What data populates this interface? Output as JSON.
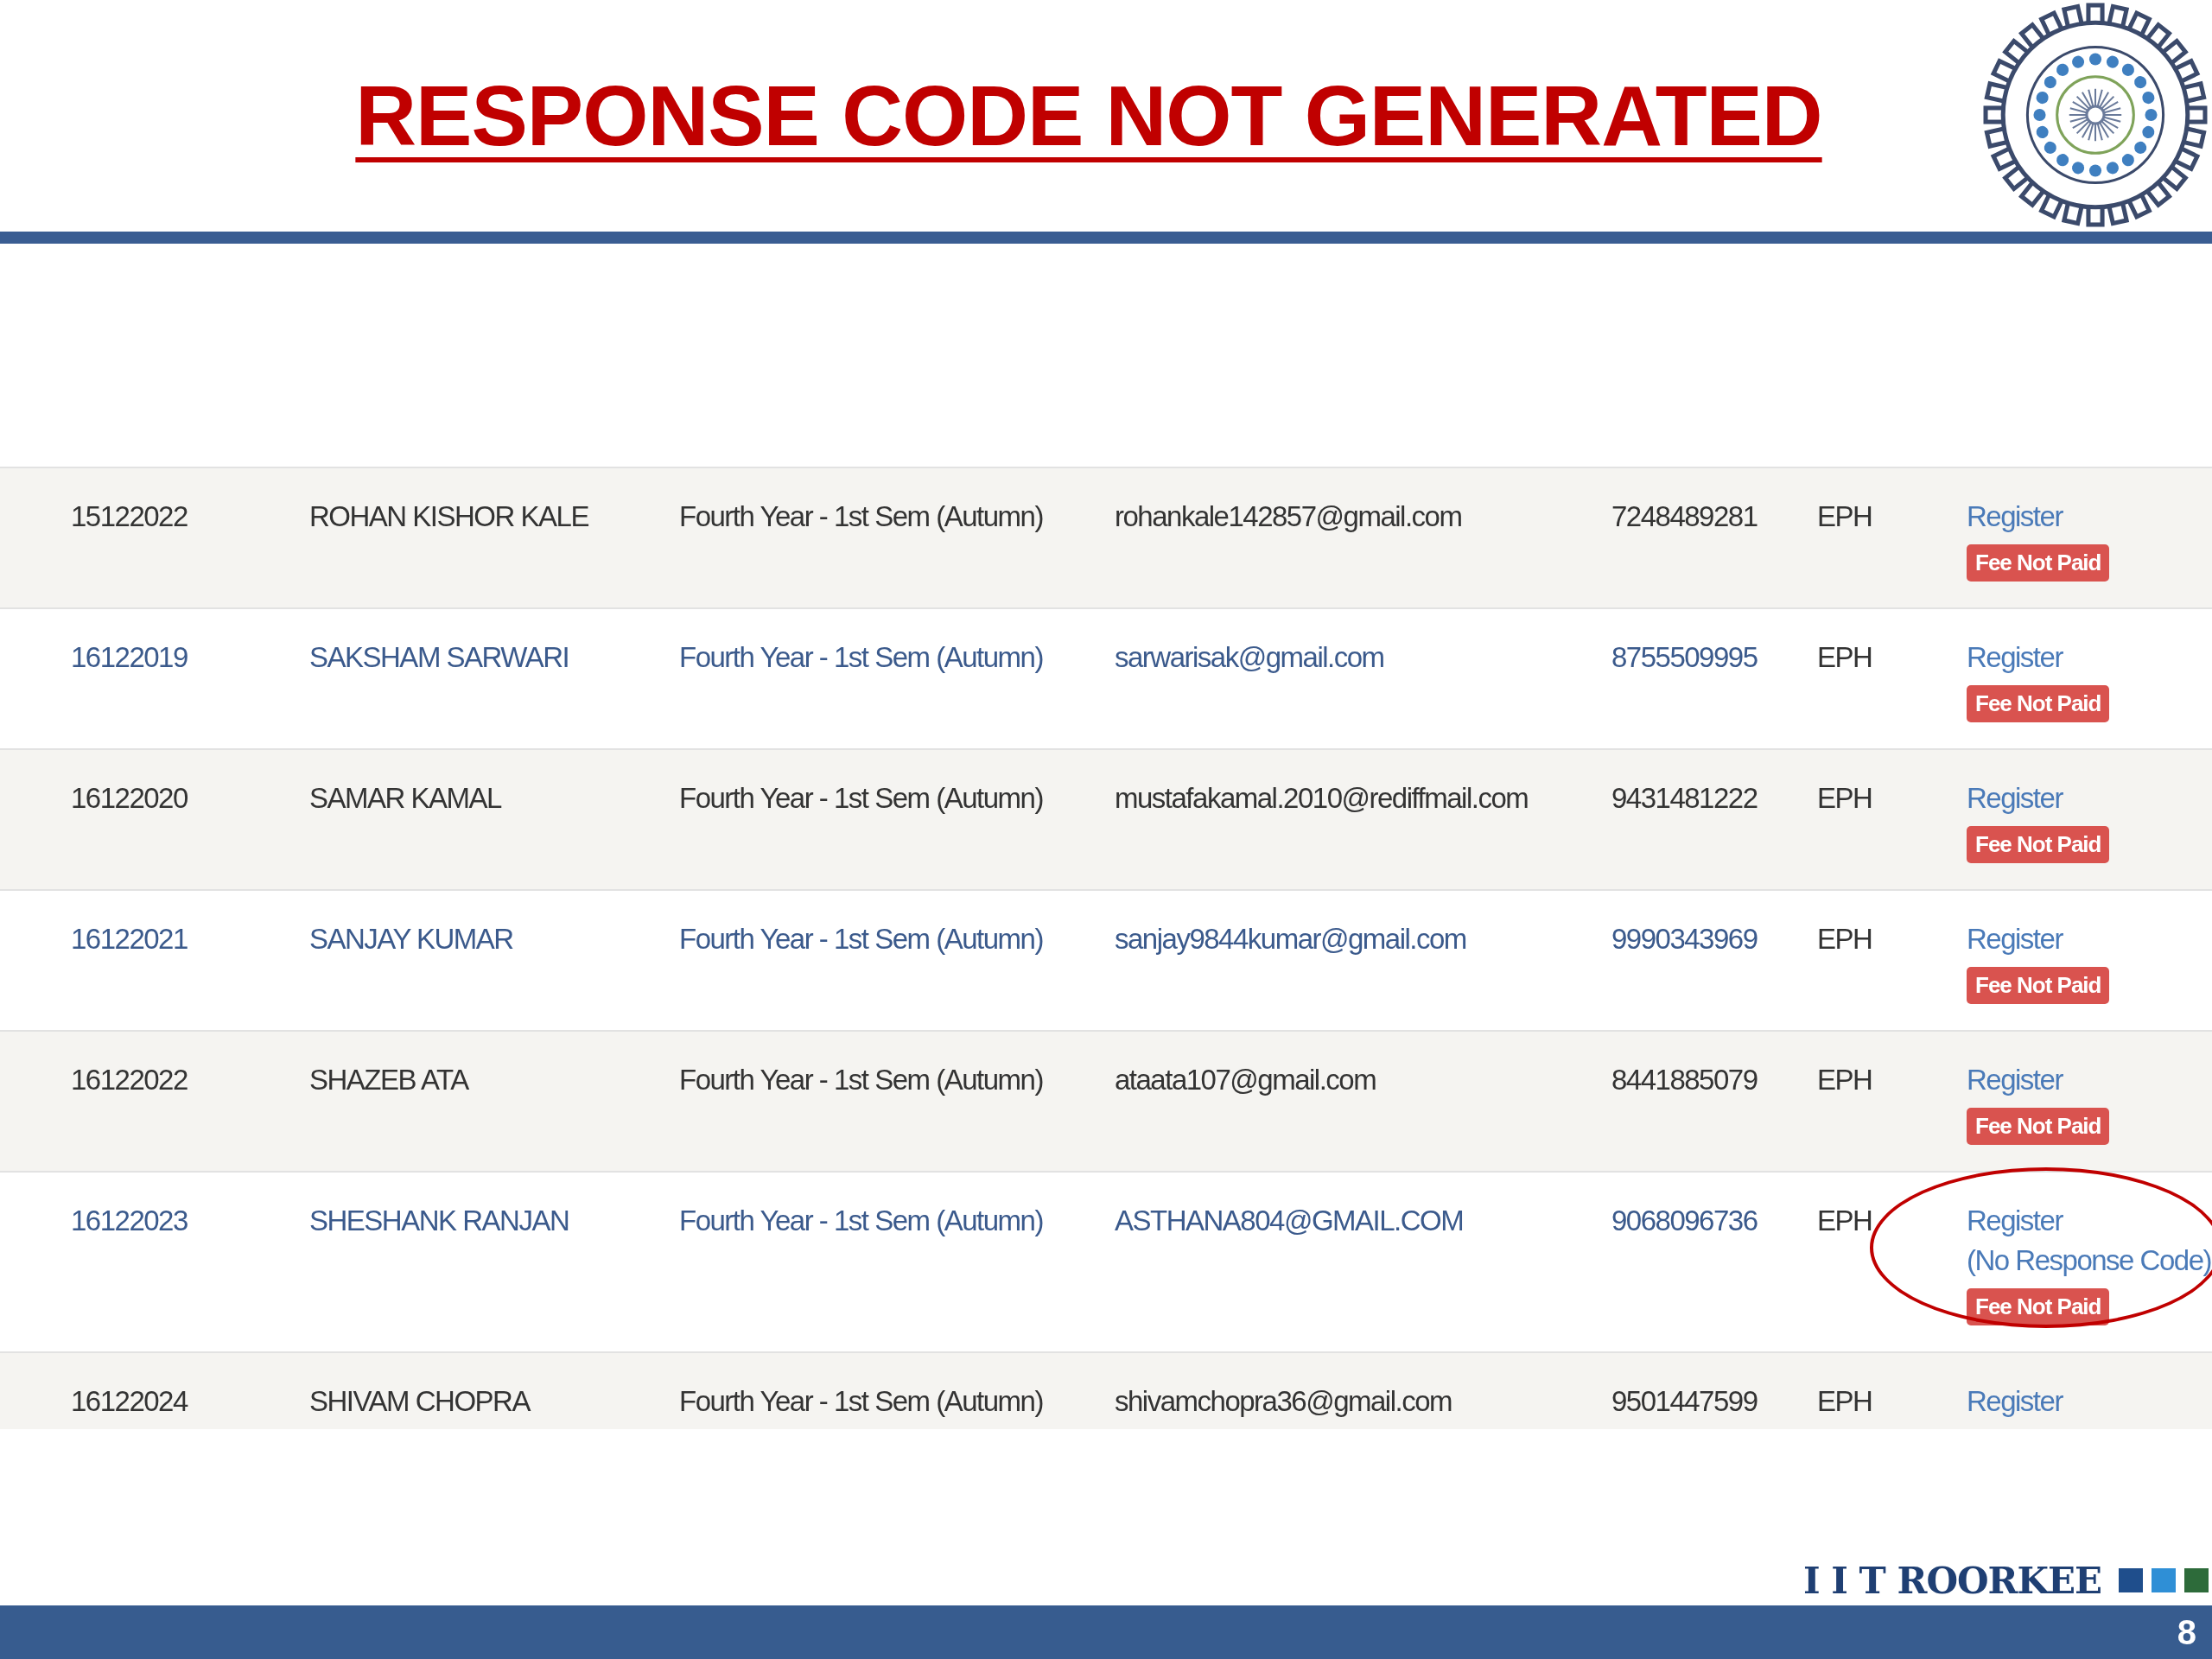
{
  "slide": {
    "title": "RESPONSE CODE NOT GENERATED",
    "footer_brand": "I I T ROORKEE",
    "page_number": "8"
  },
  "table": {
    "rows": [
      {
        "roll": "15122022",
        "name": "ROHAN KISHOR KALE",
        "semester": "Fourth Year - 1st Sem (Autumn)",
        "email": "rohankale142857@gmail.com",
        "phone": "7248489281",
        "department": "EPH",
        "action": "Register",
        "badge": "Fee Not Paid",
        "link_style": false,
        "circled": false
      },
      {
        "roll": "16122019",
        "name": "SAKSHAM SARWARI",
        "semester": "Fourth Year - 1st Sem (Autumn)",
        "email": "sarwarisak@gmail.com",
        "phone": "8755509995",
        "department": "EPH",
        "action": "Register",
        "badge": "Fee Not Paid",
        "link_style": true,
        "circled": false
      },
      {
        "roll": "16122020",
        "name": "SAMAR KAMAL",
        "semester": "Fourth Year - 1st Sem (Autumn)",
        "email": "mustafakamal.2010@rediffmail.com",
        "phone": "9431481222",
        "department": "EPH",
        "action": "Register",
        "badge": "Fee Not Paid",
        "link_style": false,
        "circled": false
      },
      {
        "roll": "16122021",
        "name": "SANJAY KUMAR",
        "semester": "Fourth Year - 1st Sem (Autumn)",
        "email": "sanjay9844kumar@gmail.com",
        "phone": "9990343969",
        "department": "EPH",
        "action": "Register",
        "badge": "Fee Not Paid",
        "link_style": true,
        "circled": false
      },
      {
        "roll": "16122022",
        "name": "SHAZEB ATA",
        "semester": "Fourth Year - 1st Sem (Autumn)",
        "email": "ataata107@gmail.com",
        "phone": "8441885079",
        "department": "EPH",
        "action": "Register",
        "badge": "Fee Not Paid",
        "link_style": false,
        "circled": false
      },
      {
        "roll": "16122023",
        "name": "SHESHANK RANJAN",
        "semester": "Fourth Year - 1st Sem (Autumn)",
        "email": "ASTHANA804@GMAIL.COM",
        "phone": "9068096736",
        "department": "EPH",
        "action": "Register",
        "note": "(No Response Code)",
        "badge": "Fee Not Paid",
        "link_style": true,
        "circled": true
      },
      {
        "roll": "16122024",
        "name": "SHIVAM CHOPRA",
        "semester": "Fourth Year - 1st Sem (Autumn)",
        "email": "shivamchopra36@gmail.com",
        "phone": "9501447599",
        "department": "EPH",
        "action": "Register",
        "link_style": false,
        "circled": false
      }
    ]
  }
}
